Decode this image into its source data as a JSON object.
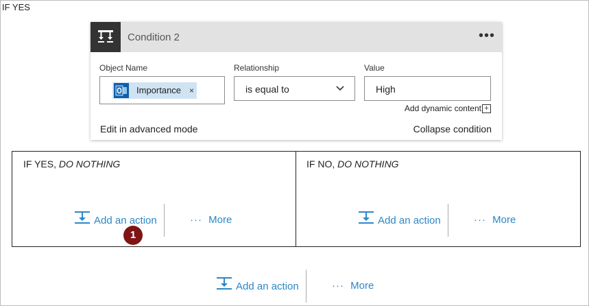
{
  "outer": {
    "label": "IF YES"
  },
  "condition": {
    "title": "Condition 2",
    "menu_icon": "ellipsis-icon",
    "object_name": {
      "label": "Object Name",
      "token_text": "Importance",
      "token_icon": "outlook-icon",
      "remove_glyph": "×"
    },
    "relationship": {
      "label": "Relationship",
      "value": "is equal to"
    },
    "value": {
      "label": "Value",
      "value": "High"
    },
    "add_dynamic": "Add dynamic content",
    "plus_glyph": "+",
    "advanced_link": "Edit in advanced mode",
    "collapse_link": "Collapse condition"
  },
  "branches": {
    "yes": {
      "label_prefix": "IF YES, ",
      "label_em": "DO NOTHING",
      "add_action": "Add an action",
      "more_dots": "···",
      "more": "More"
    },
    "no": {
      "label_prefix": "IF NO, ",
      "label_em": "DO NOTHING",
      "add_action": "Add an action",
      "more_dots": "···",
      "more": "More"
    }
  },
  "bottom": {
    "add_action": "Add an action",
    "more_dots": "···",
    "more": "More"
  },
  "badge": "1",
  "colors": {
    "accent": "#2b87c8",
    "badge": "#7f1414",
    "header": "#e2e2e2",
    "token": "#cfe3f3",
    "icon_box": "#333333"
  }
}
